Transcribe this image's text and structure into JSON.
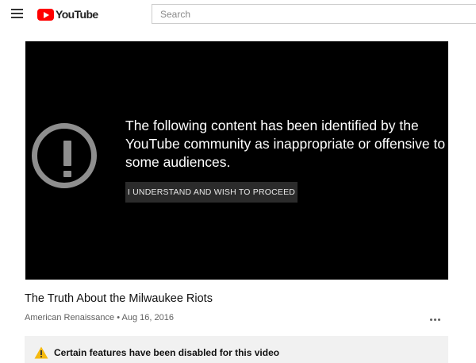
{
  "header": {
    "logo_text": "YouTube",
    "search_placeholder": "Search"
  },
  "player": {
    "warning_message": "The following content has been identified by the YouTube community as inappropriate or offensive to some audiences.",
    "proceed_label": "I UNDERSTAND AND WISH TO PROCEED",
    "warning_icon": "exclamation-circle-icon"
  },
  "video": {
    "title": "The Truth About the Milwaukee Riots",
    "channel": "American Renaissance",
    "separator": "•",
    "date": "Aug 16, 2016"
  },
  "notice": {
    "text": "Certain features have been disabled for this video",
    "icon": "warning-triangle-icon"
  },
  "colors": {
    "brand_red": "#ff0000",
    "player_bg": "#000000",
    "warning_gray": "#8e8e8e",
    "notice_bg": "#f1f1f1",
    "warning_yellow": "#f5b90f"
  }
}
